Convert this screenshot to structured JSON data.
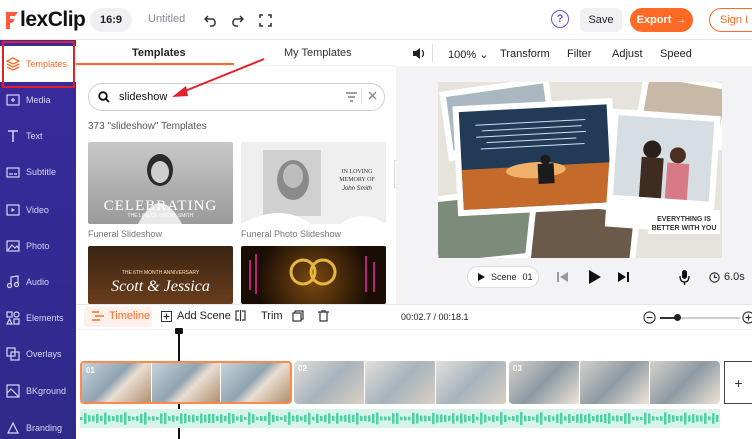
{
  "app": {
    "logo_prefix": "F",
    "logo_rest": "lexClip"
  },
  "topbar": {
    "ratio": "16:9",
    "project_name": "Untitled",
    "help": "?",
    "save": "Save",
    "export": "Export",
    "export_arrow": "→",
    "signin": "Sign I"
  },
  "sidebar": {
    "items": [
      {
        "label": "Templates",
        "icon": "layers-icon"
      },
      {
        "label": "Media",
        "icon": "media-icon"
      },
      {
        "label": "Text",
        "icon": "text-icon"
      },
      {
        "label": "Subtitle",
        "icon": "subtitle-icon"
      },
      {
        "label": "Video",
        "icon": "video-icon"
      },
      {
        "label": "Photo",
        "icon": "photo-icon"
      },
      {
        "label": "Audio",
        "icon": "audio-icon"
      },
      {
        "label": "Elements",
        "icon": "elements-icon"
      },
      {
        "label": "Overlays",
        "icon": "overlays-icon"
      },
      {
        "label": "BKground",
        "icon": "background-icon"
      },
      {
        "label": "Branding",
        "icon": "branding-icon"
      }
    ]
  },
  "templates_panel": {
    "tabs": [
      "Templates",
      "My Templates"
    ],
    "search_value": "slideshow",
    "count_text": "373 \"slideshow\" Templates",
    "cards": [
      {
        "title": "Funeral Slideshow",
        "overlay_title": "CELEBRATING",
        "overlay_sub": "THE LIFE OF HARRY SMITH"
      },
      {
        "title": "Funeral Photo Slideshow",
        "overlay_title": "IN LOVING MEMORY OF",
        "overlay_sub": "John Smith"
      },
      {
        "title": "",
        "overlay_title": "Scott & Jessica",
        "overlay_sub": "THE 6TH MONTH ANNIVERSARY"
      },
      {
        "title": "",
        "overlay_title": "",
        "overlay_sub": ""
      }
    ]
  },
  "preview_toolbar": {
    "zoom": "100%",
    "items": [
      "Transform",
      "Filter",
      "Adjust",
      "Speed"
    ]
  },
  "preview": {
    "card_text_main": "EVERYTHING IS BETTER WITH YOU",
    "scene_label": "Scene",
    "scene_number": "01",
    "duration": "6.0s"
  },
  "timeline_bar": {
    "timeline": "Timeline",
    "add_scene": "Add Scene",
    "trim": "Trim",
    "time": "00:02.7 / 00:18.1"
  },
  "timeline": {
    "clips": [
      {
        "number": "01",
        "frames": 3
      },
      {
        "number": "02",
        "frames": 3
      },
      {
        "number": "03",
        "frames": 3
      }
    ]
  },
  "colors": {
    "accent": "#ff6a27",
    "sidebar": "#3a2a9d",
    "purple": "#6b4de6",
    "annotation": "#e0202a",
    "waveform": "#4fd1a5"
  }
}
